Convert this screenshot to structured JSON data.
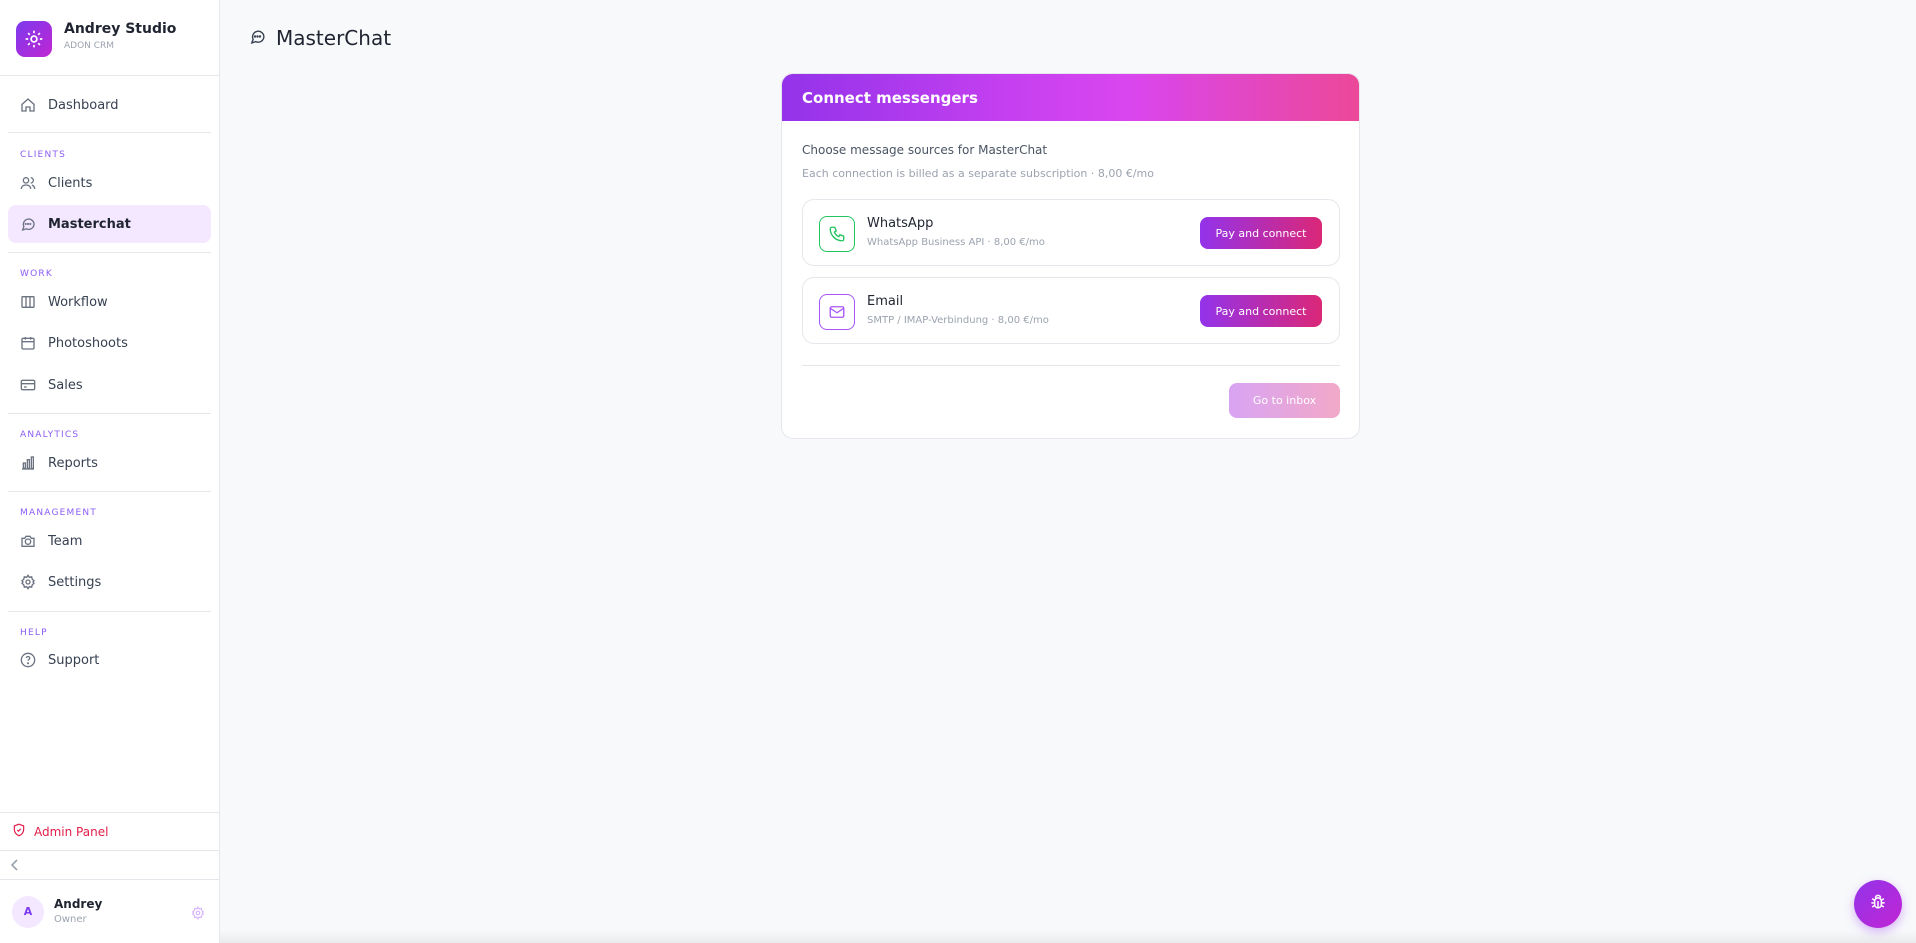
{
  "brand": {
    "name": "Andrey Studio",
    "subtitle": "ADON CRM"
  },
  "nav": {
    "dashboard": "Dashboard",
    "sections": {
      "clients": "CLIENTS",
      "work": "WORK",
      "analytics": "ANALYTICS",
      "management": "MANAGEMENT",
      "help": "HELP"
    },
    "clients": "Clients",
    "masterchat": "Masterchat",
    "workflow": "Workflow",
    "photoshoots": "Photoshoots",
    "sales": "Sales",
    "reports": "Reports",
    "team": "Team",
    "settings": "Settings",
    "support": "Support",
    "active": "masterchat"
  },
  "admin_panel": "Admin Panel",
  "user": {
    "initial": "A",
    "name": "Andrey",
    "role": "Owner"
  },
  "page": {
    "title": "MasterChat"
  },
  "card": {
    "title": "Connect messengers",
    "subtitle": "Choose message sources for MasterChat",
    "note": "Each connection is billed as a separate subscription · 8,00 €/mo",
    "sources": [
      {
        "name": "WhatsApp",
        "description": "WhatsApp Business API · 8,00 €/mo",
        "button": "Pay and connect",
        "icon": "phone-icon"
      },
      {
        "name": "Email",
        "description": "SMTP / IMAP-Verbindung · 8,00 €/mo",
        "button": "Pay and connect",
        "icon": "mail-icon"
      }
    ],
    "go_to_inbox": "Go to inbox"
  },
  "colors": {
    "accent": "#9333ea",
    "accent_pink": "#ec4899",
    "admin_red": "#e11d48",
    "whatsapp_green": "#22c55e"
  }
}
